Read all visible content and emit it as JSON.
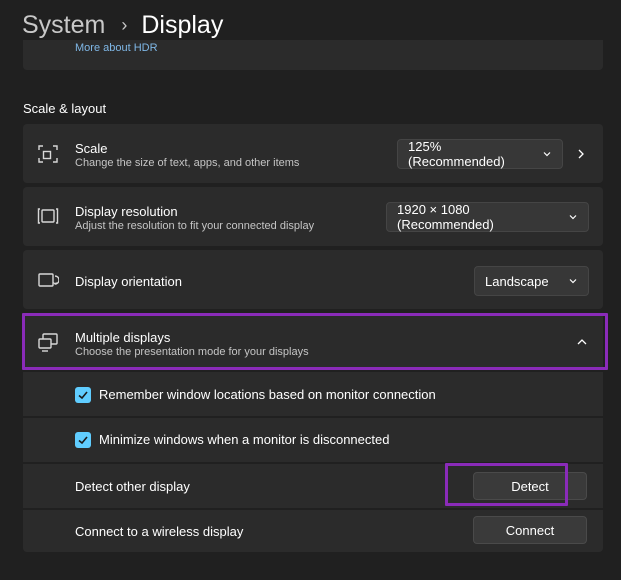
{
  "breadcrumb": {
    "parent": "System",
    "current": "Display"
  },
  "hdr": {
    "link": "More about HDR"
  },
  "section": {
    "title": "Scale & layout"
  },
  "scale": {
    "title": "Scale",
    "subtitle": "Change the size of text, apps, and other items",
    "value": "125% (Recommended)"
  },
  "resolution": {
    "title": "Display resolution",
    "subtitle": "Adjust the resolution to fit your connected display",
    "value": "1920 × 1080 (Recommended)"
  },
  "orientation": {
    "title": "Display orientation",
    "value": "Landscape"
  },
  "multiple": {
    "title": "Multiple displays",
    "subtitle": "Choose the presentation mode for your displays",
    "options": [
      {
        "label": "Remember window locations based on monitor connection",
        "checked": true
      },
      {
        "label": "Minimize windows when a monitor is disconnected",
        "checked": true
      }
    ],
    "detect_label": "Detect other display",
    "detect_button": "Detect",
    "wireless_label": "Connect to a wireless display",
    "wireless_button": "Connect"
  },
  "colors": {
    "accent": "#60cdff",
    "highlight": "#8a2bb9",
    "link": "#7fb7e6"
  }
}
